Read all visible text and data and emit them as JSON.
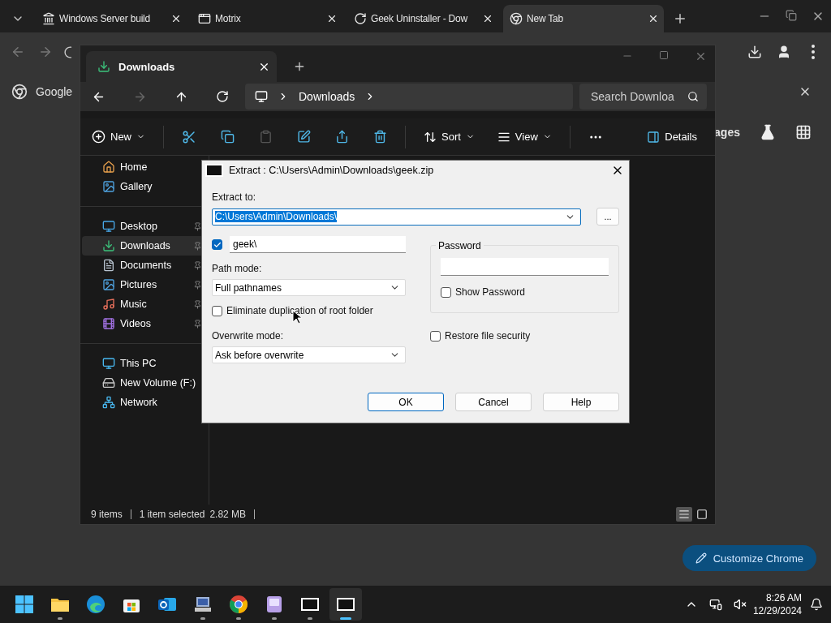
{
  "browser": {
    "tabs": [
      {
        "title": "Windows Server build",
        "selected": false
      },
      {
        "title": "Motrix",
        "selected": false
      },
      {
        "title": "Geek Uninstaller - Dow",
        "selected": false
      },
      {
        "title": "New Tab",
        "selected": true
      }
    ],
    "shortcut_label": "Google",
    "partial_link": "ages",
    "customize_button": "Customize Chrome"
  },
  "explorer": {
    "tab_title": "Downloads",
    "breadcrumb": [
      "Downloads"
    ],
    "search_placeholder": "Search Downloa",
    "toolbar": {
      "new": "New",
      "sort": "Sort",
      "view": "View",
      "details": "Details"
    },
    "sidebar_groups": [
      [
        {
          "label": "Home",
          "pinned": false,
          "selected": false
        },
        {
          "label": "Gallery",
          "pinned": false,
          "selected": false
        }
      ],
      [
        {
          "label": "Desktop",
          "pinned": true,
          "selected": false
        },
        {
          "label": "Downloads",
          "pinned": true,
          "selected": true
        },
        {
          "label": "Documents",
          "pinned": true,
          "selected": false
        },
        {
          "label": "Pictures",
          "pinned": true,
          "selected": false
        },
        {
          "label": "Music",
          "pinned": true,
          "selected": false
        },
        {
          "label": "Videos",
          "pinned": true,
          "selected": false
        }
      ],
      [
        {
          "label": "This PC",
          "pinned": false,
          "selected": false
        },
        {
          "label": "New Volume (F:)",
          "pinned": false,
          "selected": false
        },
        {
          "label": "Network",
          "pinned": false,
          "selected": false
        }
      ]
    ],
    "status": {
      "items": "9 items",
      "selection": "1 item selected",
      "size": "2.82 MB"
    },
    "view_modes": [
      {
        "kind": "details",
        "selected": true
      },
      {
        "kind": "tiles",
        "selected": false
      }
    ]
  },
  "dialog": {
    "title": "Extract : C:\\Users\\Admin\\Downloads\\geek.zip",
    "extract_to_label": "Extract to:",
    "extract_to_value": "C:\\Users\\Admin\\Downloads\\",
    "extract_to_text_selected": true,
    "browse_button": "...",
    "subfolder": {
      "checked": true,
      "value": "geek\\"
    },
    "path_mode_label": "Path mode:",
    "path_mode_value": "Full pathnames",
    "eliminate": {
      "label": "Eliminate duplication of root folder",
      "checked": false
    },
    "overwrite_label": "Overwrite mode:",
    "overwrite_value": "Ask before overwrite",
    "password_label": "Password",
    "show_password": {
      "label": "Show Password",
      "checked": false
    },
    "restore_security": {
      "label": "Restore file security",
      "checked": false
    },
    "buttons": [
      {
        "label": "OK",
        "default": true
      },
      {
        "label": "Cancel",
        "default": false
      },
      {
        "label": "Help",
        "default": false
      }
    ]
  },
  "taskbar": {
    "apps": [
      {
        "kind": "start",
        "running": false,
        "active": false
      },
      {
        "kind": "explorer",
        "running": true,
        "active": false
      },
      {
        "kind": "edge",
        "running": false,
        "active": false
      },
      {
        "kind": "store",
        "running": false,
        "active": false
      },
      {
        "kind": "outlook",
        "running": false,
        "active": false
      },
      {
        "kind": "remote",
        "running": true,
        "active": false
      },
      {
        "kind": "chrome",
        "running": true,
        "active": false
      },
      {
        "kind": "app",
        "running": true,
        "active": false
      },
      {
        "kind": "archive",
        "running": true,
        "active": false
      },
      {
        "kind": "archive",
        "running": true,
        "active": true
      }
    ],
    "time": "8:26 AM",
    "date": "12/29/2024"
  }
}
